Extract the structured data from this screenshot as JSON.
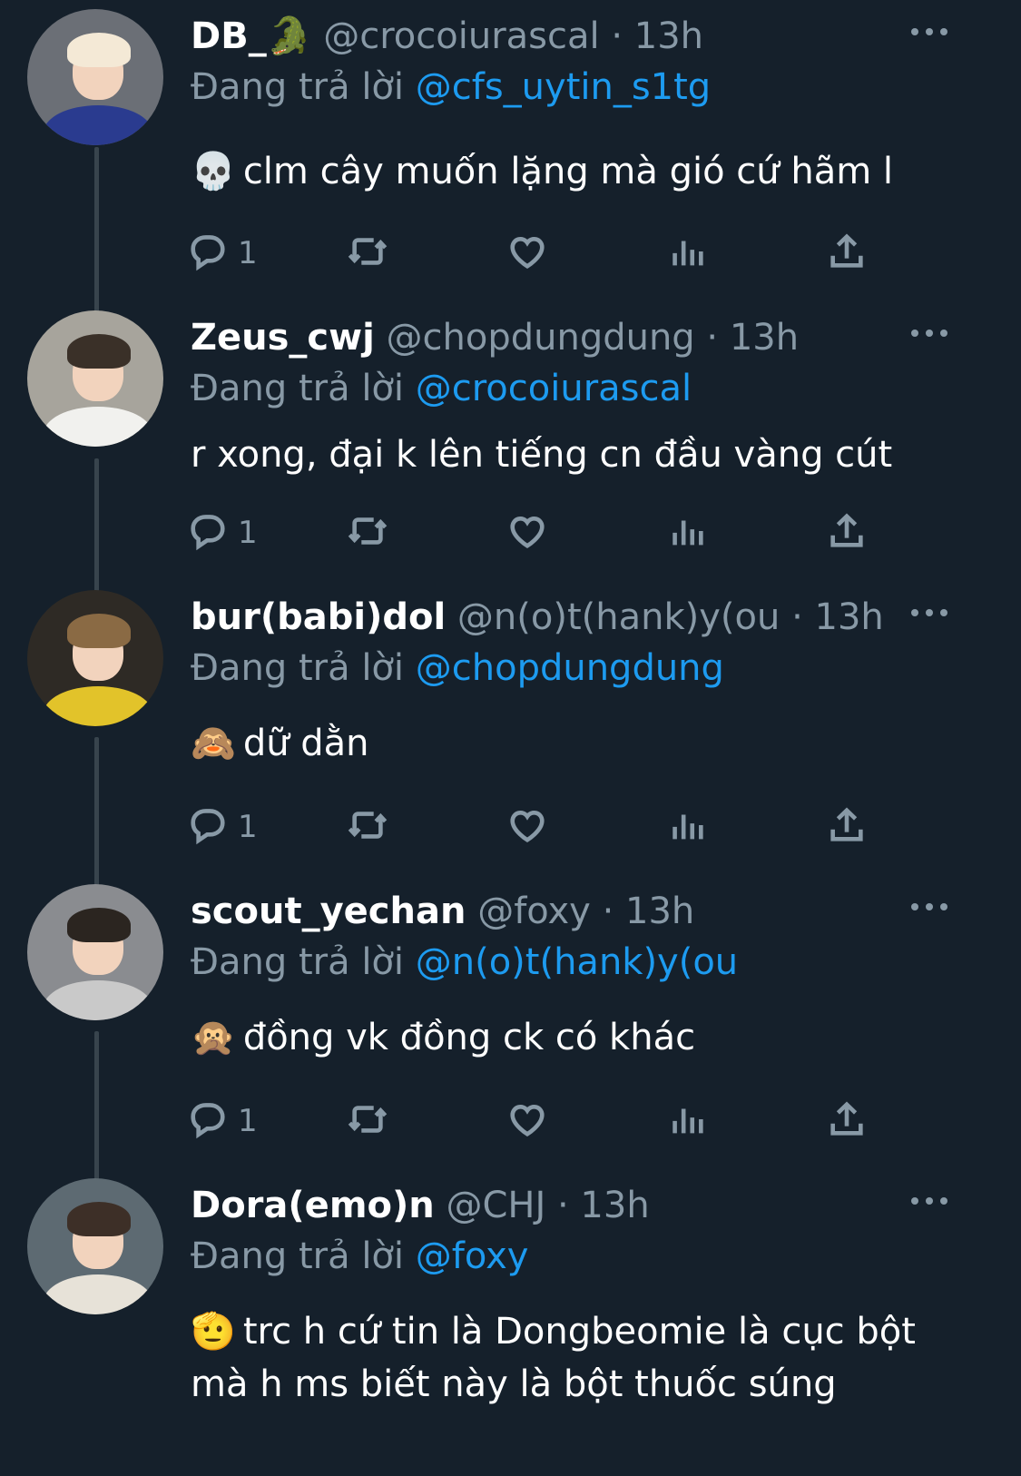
{
  "tweets": [
    {
      "display_name": "DB_",
      "name_emoji": "🐊",
      "handle": "@crocoiurascal",
      "separator": "·",
      "time": "13h",
      "reply_prefix": "Đang trả lời",
      "reply_to": "@cfs_uytin_s1tg",
      "emoji": "💀",
      "text": "clm cây muốn lặng mà gió cứ hãm l",
      "reply_count": "1",
      "avatar_icon": "avatar-photo-icon"
    },
    {
      "display_name": "Zeus_cwj",
      "name_emoji": "",
      "handle": "@chopdungdung",
      "separator": "·",
      "time": "13h",
      "reply_prefix": "Đang trả lời",
      "reply_to": "@crocoiurascal",
      "emoji": "",
      "text": "r xong, đại k lên tiếng cn đầu vàng cút",
      "reply_count": "1",
      "avatar_icon": "avatar-photo-icon"
    },
    {
      "display_name": "bur(babi)dol",
      "name_emoji": "",
      "handle": "@n(o)t(hank)y(ou",
      "separator": "·",
      "time": "13h",
      "reply_prefix": "Đang trả lời",
      "reply_to": "@chopdungdung",
      "emoji": "🙈",
      "text": "dữ dằn",
      "reply_count": "1",
      "avatar_icon": "avatar-photo-icon"
    },
    {
      "display_name": "scout_yechan",
      "name_emoji": "",
      "handle": "@foxy",
      "separator": "·",
      "time": "13h",
      "reply_prefix": "Đang trả lời",
      "reply_to": "@n(o)t(hank)y(ou",
      "emoji": "🙊",
      "text": "đồng vk đồng ck có khác",
      "reply_count": "1",
      "avatar_icon": "avatar-photo-icon"
    },
    {
      "display_name": "Dora(emo)n",
      "name_emoji": "",
      "handle": "@CHJ",
      "separator": "·",
      "time": "13h",
      "reply_prefix": "Đang trả lời",
      "reply_to": "@foxy",
      "emoji": "🫡",
      "text": "trc h cứ tin là Dongbeomie là cục bột mà h ms biết này là bột thuốc súng",
      "reply_count": "",
      "avatar_icon": "avatar-photo-icon"
    }
  ],
  "icons": {
    "reply": "reply-icon",
    "retweet": "retweet-icon",
    "like": "heart-icon",
    "views": "views-icon",
    "share": "share-icon",
    "more": "more-icon"
  },
  "colors": {
    "background": "#15202b",
    "secondary_text": "#8899a6",
    "mention": "#1d9bf0",
    "thread_line": "#38444d"
  }
}
